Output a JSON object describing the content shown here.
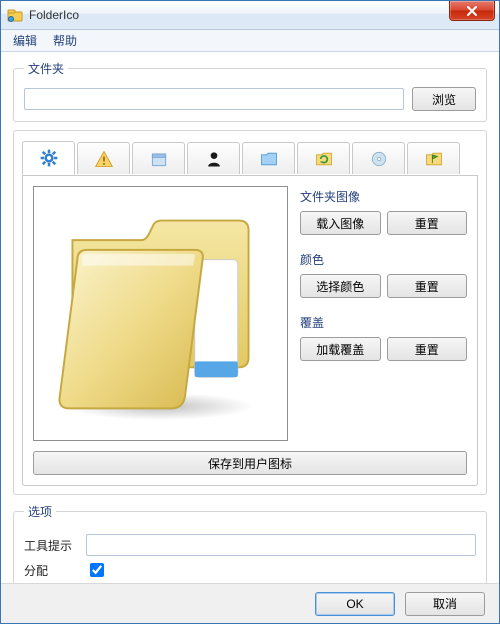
{
  "window": {
    "title": "FolderIco"
  },
  "menu": {
    "edit": "编辑",
    "help": "帮助"
  },
  "folder_group": {
    "legend": "文件夹",
    "path_value": "",
    "browse": "浏览"
  },
  "tabs": {
    "items": [
      {
        "name": "gear"
      },
      {
        "name": "warn"
      },
      {
        "name": "box"
      },
      {
        "name": "profile"
      },
      {
        "name": "folder"
      },
      {
        "name": "refresh"
      },
      {
        "name": "disc"
      },
      {
        "name": "flag"
      }
    ]
  },
  "controls": {
    "image_label": "文件夹图像",
    "image_load": "载入图像",
    "image_reset": "重置",
    "color_label": "颜色",
    "color_pick": "选择颜色",
    "color_reset": "重置",
    "overlay_label": "覆盖",
    "overlay_load": "加载覆盖",
    "overlay_reset": "重置",
    "save_user_icon": "保存到用户图标"
  },
  "options": {
    "legend": "选项",
    "tooltip_label": "工具提示",
    "tooltip_value": "",
    "assign_label": "分配",
    "assign_checked": true
  },
  "buttons": {
    "ok": "OK",
    "cancel": "取消"
  }
}
